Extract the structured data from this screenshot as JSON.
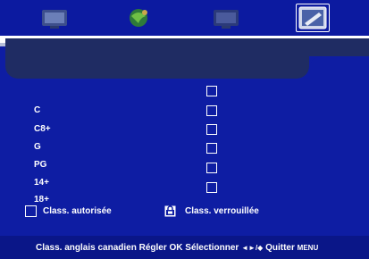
{
  "tabs": [
    {
      "icon": "tv-screen-icon"
    },
    {
      "icon": "satellite-globe-icon"
    },
    {
      "icon": "lock-screen-icon"
    },
    {
      "icon": "settings-pencil-icon",
      "active": true
    }
  ],
  "header": {
    "title": ""
  },
  "ratings": [
    {
      "label": "C",
      "locked": false
    },
    {
      "label": "C8+",
      "locked": false
    },
    {
      "label": "G",
      "locked": false
    },
    {
      "label": "PG",
      "locked": false
    },
    {
      "label": "14+",
      "locked": false
    },
    {
      "label": "18+",
      "locked": false
    }
  ],
  "legend": {
    "allowed": "Class. autorisée",
    "locked": "Class. verrouillée"
  },
  "footer": {
    "title": "Class. anglais canadien",
    "adjust": "Régler",
    "ok_key": "OK",
    "select": "Sélectionner",
    "arrows": "◄►/◆",
    "quit": "Quitter",
    "menu_key": "MENU"
  },
  "colors": {
    "background": "#0e1da3",
    "header": "#1f2c63",
    "text": "#ffffff"
  }
}
